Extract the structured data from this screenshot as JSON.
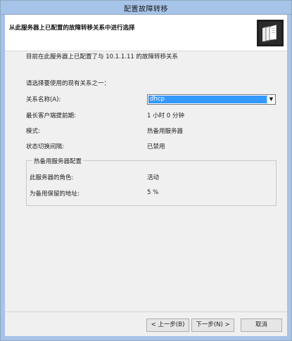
{
  "window": {
    "title": "配置故障转移"
  },
  "header": {
    "title": "从此服务器上已配置的故障转移关系中进行选择",
    "icon": "folder-stack-icon"
  },
  "main": {
    "intro": "目前在此服务器上已配置了与 10.1.1.11 的故障转移关系",
    "prompt": "请选择要使用的现有关系之一：",
    "relationship_label": "关系名称(A):",
    "relationship_value": "dhcp",
    "mclt_label": "最长客户端提前期:",
    "mclt_value": "1 小时 0 分钟",
    "mode_label": "模式:",
    "mode_value": "热备用服务器",
    "switchover_label": "状态切换间隔:",
    "switchover_value": "已禁用",
    "hot_standby": {
      "legend": "热备用服务器配置",
      "role_label": "此服务器的角色:",
      "role_value": "活动",
      "reserve_label": "为备用保留的地址:",
      "reserve_value": "5 %"
    }
  },
  "footer": {
    "back_label": "< 上一步(B)",
    "next_label": "下一步(N) >",
    "cancel_label": "取消"
  }
}
